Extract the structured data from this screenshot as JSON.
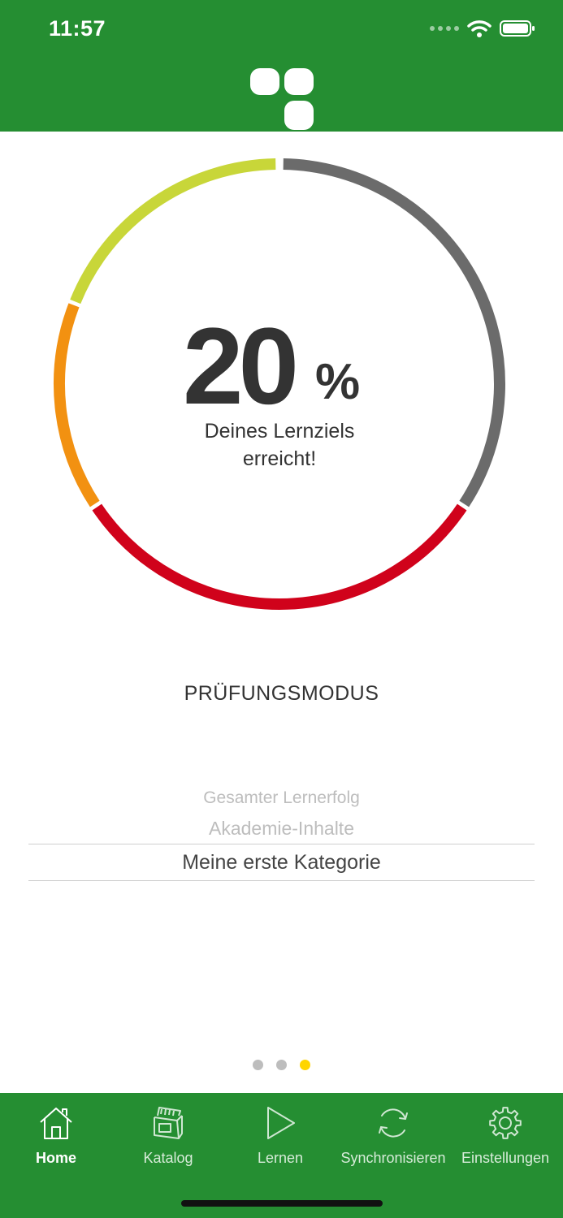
{
  "status_bar": {
    "time": "11:57"
  },
  "progress": {
    "value": "20",
    "unit": "%",
    "caption_line1": "Deines Lernziels",
    "caption_line2": "erreicht!",
    "fraction": 0.2
  },
  "ring_colors": {
    "red": "#d0021b",
    "orange": "#f29111",
    "yellow_green": "#c8d639",
    "remaining": "#6b6b6b"
  },
  "mode_title": "PRÜFUNGSMODUS",
  "picker": {
    "items": [
      "Gesamter Lernerfolg",
      "Akademie-Inhalte"
    ],
    "selected": "Meine erste Kategorie"
  },
  "page_indicator": {
    "count": 3,
    "active": 3
  },
  "tabbar": {
    "tabs": [
      {
        "label": "Home",
        "icon": "home-icon"
      },
      {
        "label": "Katalog",
        "icon": "catalog-icon"
      },
      {
        "label": "Lernen",
        "icon": "play-icon"
      },
      {
        "label": "Synchronisieren",
        "icon": "sync-icon"
      },
      {
        "label": "Einstellungen",
        "icon": "gear-icon"
      }
    ],
    "active_index": 0
  },
  "colors": {
    "brand_green": "#258e32",
    "page_dot_active": "#ffd500"
  }
}
